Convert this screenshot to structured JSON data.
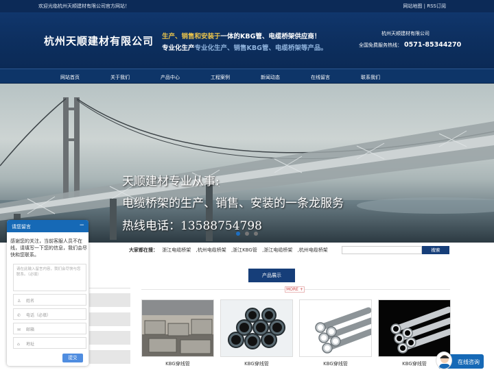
{
  "topbar": {
    "welcome": "欢迎光临杭州天顺建材有限公司官方网站！",
    "sitemap": "网站地图",
    "sep": "|",
    "rss": "RSS订阅"
  },
  "header": {
    "logo": "杭州天顺建材有限公司",
    "slogan1_a": "生产、销售和安装于",
    "slogan1_b": "一体的KBG管、电缆桥架供应商！",
    "slogan2_a": "专业化生产",
    "slogan2_b": "专业化生产、销售KBG管、电缆桥架等产品。",
    "company_name": "杭州天顺建材有限公司",
    "hotline_label": "全国免费服务热线：",
    "hotline": "0571-85344270"
  },
  "nav": [
    "网站首页",
    "关于我们",
    "产品中心",
    "工程案例",
    "新闻动态",
    "在线留言",
    "联系我们"
  ],
  "banner": {
    "line1": "天顺建材专业从事:",
    "line2": "电缆桥架的生产、销售、安装的一条龙服务",
    "line3": "热线电话：13588754798"
  },
  "breadcrumb": {
    "label": "大家都在搜：",
    "items": [
      "浙江电缆桥架",
      ",杭州电缆桥架",
      ",浙江KBG管",
      ",浙江电缆桥架",
      ",杭州电缆桥架"
    ]
  },
  "search": {
    "button": "搜索"
  },
  "products": {
    "heading": "产品展示",
    "more": "MORE +",
    "items": [
      "KBG穿线管",
      "KBG穿线管",
      "KBG穿线管",
      "KBG穿线管"
    ]
  },
  "chat": {
    "title": "请您留言",
    "minimize": "−",
    "message": "感谢您的关注，当前客服人员不在线，请填写一下您的信息，我们会尽快和您联系。",
    "textarea_placeholder": "请在此输入留言内容，我们会尽快与您联系。（必填）",
    "fields": [
      {
        "icon": "person-icon",
        "glyph": "♙",
        "label": "姓名"
      },
      {
        "icon": "phone-icon",
        "glyph": "✆",
        "label": "电话（必填）"
      },
      {
        "icon": "mail-icon",
        "glyph": "✉",
        "label": "邮箱"
      },
      {
        "icon": "location-icon",
        "glyph": "⌂",
        "label": "地址"
      }
    ],
    "submit": "提交"
  },
  "customer_service": {
    "label": "在线咨询"
  },
  "colors": {
    "header_bg": "#0d2f5f",
    "accent": "#1669b6",
    "gold": "#e9c34c"
  }
}
